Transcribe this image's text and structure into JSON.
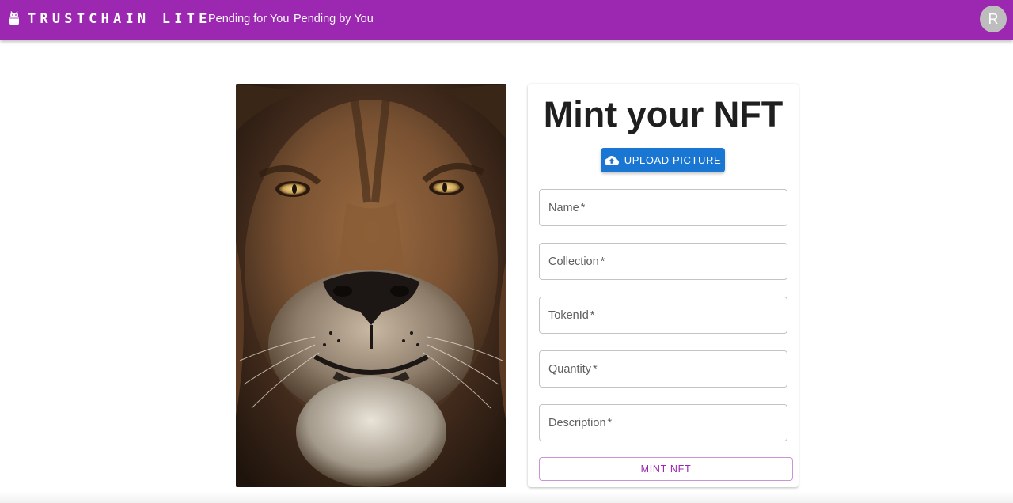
{
  "header": {
    "brand": "TRUSTCHAIN LITE",
    "nav": [
      "Pending for You",
      "Pending by You"
    ],
    "avatar_initial": "R"
  },
  "preview": {
    "subject": "lion-face-photo"
  },
  "form": {
    "title": "Mint your NFT",
    "upload_label": "UPLOAD PICTURE",
    "fields": [
      {
        "label": "Name",
        "required": "*",
        "value": ""
      },
      {
        "label": "Collection",
        "required": "*",
        "value": ""
      },
      {
        "label": "TokenId",
        "required": "*",
        "value": ""
      },
      {
        "label": "Quantity",
        "required": "*",
        "value": ""
      },
      {
        "label": "Description",
        "required": "*",
        "value": ""
      }
    ],
    "submit_label": "MINT NFT"
  },
  "colors": {
    "appbar": "#9c27b0",
    "primary": "#1976d2",
    "secondary": "#9c27b0"
  }
}
